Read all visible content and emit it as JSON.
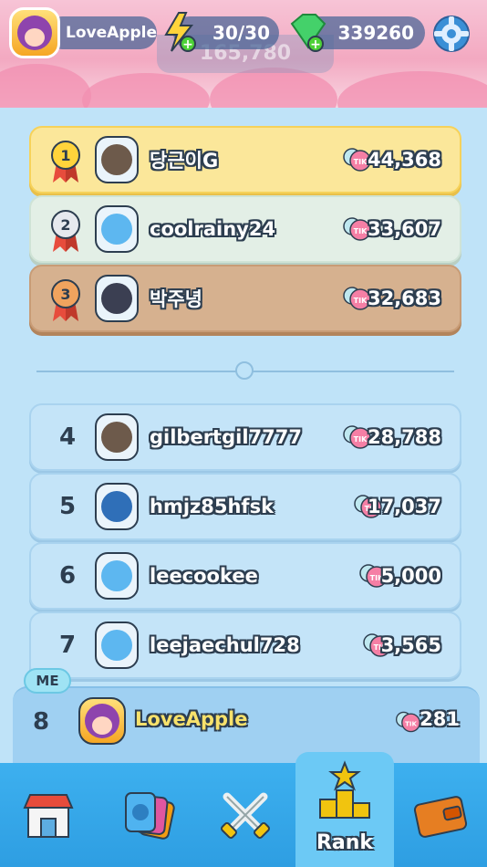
{
  "hud": {
    "username": "LoveApple",
    "energy": "30/30",
    "gems": "339260",
    "ghost_value": "165,780"
  },
  "top_ranks": [
    {
      "rank": 1,
      "name": "당근이G",
      "score": "44,368"
    },
    {
      "rank": 2,
      "name": "coolrainy24",
      "score": "33,607"
    },
    {
      "rank": 3,
      "name": "박주녕",
      "score": "32,683"
    }
  ],
  "ranks": [
    {
      "rank": "4",
      "name": "gilbertgil7777",
      "score": "28,788"
    },
    {
      "rank": "5",
      "name": "hmjz85hfsk",
      "score": "17,037"
    },
    {
      "rank": "6",
      "name": "leecookee",
      "score": "5,000"
    },
    {
      "rank": "7",
      "name": "leejaechul728",
      "score": "3,565"
    }
  ],
  "me": {
    "badge": "ME",
    "rank": "8",
    "name": "LoveApple",
    "score": "281"
  },
  "nav": {
    "rank_label": "Rank"
  },
  "icons": {
    "energy": "lightning-icon",
    "gems": "gem-icon",
    "settings": "gear-icon",
    "currency": "tik-coin-icon"
  },
  "colors": {
    "gold_row": "#fbe79a",
    "silver_row": "#e3efe6",
    "bronze_row": "#d6b18f",
    "normal_row": "#c4e4f8",
    "nav_bg": "#3db0ef",
    "me_name": "#f7e16b"
  }
}
